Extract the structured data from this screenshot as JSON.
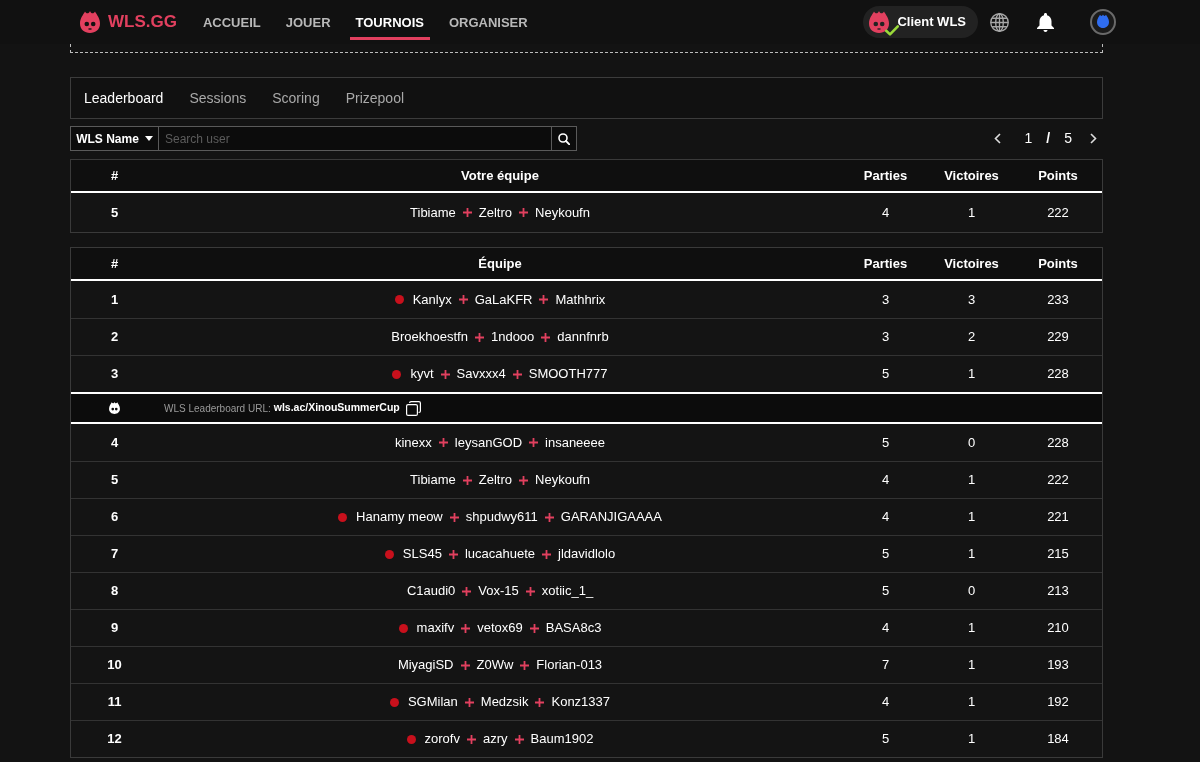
{
  "navbar": {
    "brand": "WLS.GG",
    "links": [
      {
        "label": "ACCUEIL",
        "selected": false
      },
      {
        "label": "JOUER",
        "selected": false
      },
      {
        "label": "TOURNOIS",
        "selected": true
      },
      {
        "label": "ORGANISER",
        "selected": false
      }
    ],
    "client": {
      "label": "Client WLS",
      "connected": true
    }
  },
  "tabs": [
    {
      "label": "Leaderboard",
      "selected": true
    },
    {
      "label": "Sessions",
      "selected": false
    },
    {
      "label": "Scoring",
      "selected": false
    },
    {
      "label": "Prizepool",
      "selected": false
    }
  ],
  "search": {
    "filter": "WLS Name",
    "placeholder": "Search user"
  },
  "pagination": {
    "current": "1",
    "separator": "/",
    "total": "5"
  },
  "my_team": {
    "columns": [
      "#",
      "Votre équipe",
      "Parties",
      "Victoires",
      "Points"
    ],
    "rows": [
      {
        "kind": "team",
        "rank": "5",
        "dot": false,
        "players": [
          "Tibiame",
          "Zeltro",
          "Neykoufn"
        ],
        "games": "4",
        "wins": "1",
        "points": "222"
      }
    ]
  },
  "leaderboard": {
    "columns": [
      "#",
      "Équipe",
      "Parties",
      "Victoires",
      "Points"
    ],
    "rows": [
      {
        "kind": "team",
        "rank": "1",
        "dot": true,
        "players": [
          "Kanlyx",
          "GaLaKFR",
          "Mathhrix"
        ],
        "games": "3",
        "wins": "3",
        "points": "233"
      },
      {
        "kind": "team",
        "rank": "2",
        "dot": false,
        "players": [
          "Broekhoestfn",
          "1ndooo",
          "dannfnrb"
        ],
        "games": "3",
        "wins": "2",
        "points": "229"
      },
      {
        "kind": "team",
        "rank": "3",
        "dot": true,
        "players": [
          "kyvt",
          "Savxxx4",
          "SMOOTH777"
        ],
        "games": "5",
        "wins": "1",
        "points": "228"
      },
      {
        "kind": "url",
        "label": "WLS Leaderboard URL:",
        "url": "wls.ac/XinouSummerCup"
      },
      {
        "kind": "team",
        "rank": "4",
        "dot": false,
        "players": [
          "kinexx",
          "leysanGOD",
          "insaneeee"
        ],
        "games": "5",
        "wins": "0",
        "points": "228"
      },
      {
        "kind": "team",
        "rank": "5",
        "dot": false,
        "players": [
          "Tibiame",
          "Zeltro",
          "Neykoufn"
        ],
        "games": "4",
        "wins": "1",
        "points": "222"
      },
      {
        "kind": "team",
        "rank": "6",
        "dot": true,
        "players": [
          "Hanamy meow",
          "shpudwy611",
          "GARANJIGAAAA"
        ],
        "games": "4",
        "wins": "1",
        "points": "221"
      },
      {
        "kind": "team",
        "rank": "7",
        "dot": true,
        "players": [
          "SLS45",
          "lucacahuete",
          "jldavidlolo"
        ],
        "games": "5",
        "wins": "1",
        "points": "215"
      },
      {
        "kind": "team",
        "rank": "8",
        "dot": false,
        "players": [
          "C1audi0",
          "Vox-15",
          "xotiic_1_"
        ],
        "games": "5",
        "wins": "0",
        "points": "213"
      },
      {
        "kind": "team",
        "rank": "9",
        "dot": true,
        "players": [
          "maxifv",
          "vetox69",
          "BASA8c3"
        ],
        "games": "4",
        "wins": "1",
        "points": "210"
      },
      {
        "kind": "team",
        "rank": "10",
        "dot": false,
        "players": [
          "MiyagiSD",
          "Z0Ww",
          "Florian-013"
        ],
        "games": "7",
        "wins": "1",
        "points": "193"
      },
      {
        "kind": "team",
        "rank": "11",
        "dot": true,
        "players": [
          "SGMilan",
          "Medzsik",
          "Konz1337"
        ],
        "games": "4",
        "wins": "1",
        "points": "192"
      },
      {
        "kind": "team",
        "rank": "12",
        "dot": true,
        "players": [
          "zorofv",
          "azry",
          "Baum1902"
        ],
        "games": "5",
        "wins": "1",
        "points": "184"
      }
    ]
  }
}
